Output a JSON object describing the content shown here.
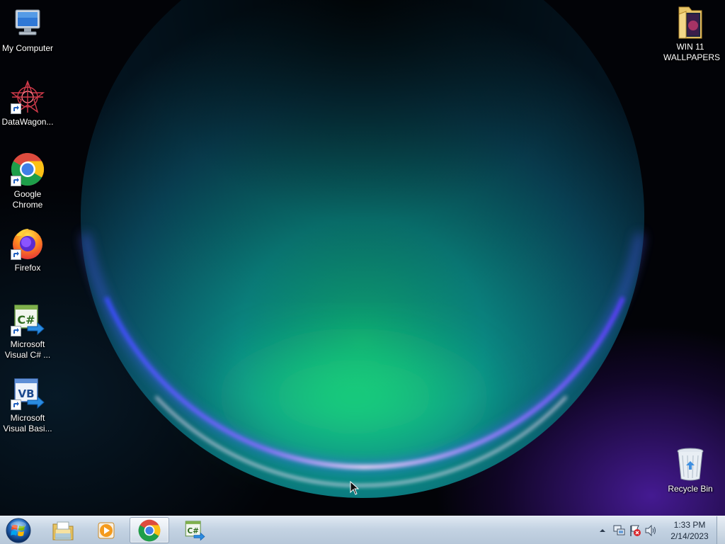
{
  "desktop": {
    "icons_left": [
      {
        "label": "My Computer",
        "icon": "computer-icon"
      },
      {
        "label": "DataWagon...",
        "icon": "datawagon-icon"
      },
      {
        "label": "Google Chrome",
        "icon": "chrome-icon"
      },
      {
        "label": "Firefox",
        "icon": "firefox-icon"
      },
      {
        "label": "Microsoft Visual C# ...",
        "icon": "visual-csharp-icon"
      },
      {
        "label": "Microsoft Visual Basi...",
        "icon": "visual-basic-icon"
      }
    ],
    "folder": {
      "label": "WIN 11 WALLPAPERS",
      "icon": "folder-icon"
    },
    "recycle_bin": {
      "label": "Recycle Bin",
      "icon": "recycle-bin-icon"
    }
  },
  "taskbar": {
    "start_icon": "windows-logo-icon",
    "pinned": [
      {
        "name": "Windows Explorer",
        "icon": "explorer-folder-icon"
      },
      {
        "name": "Windows Media Player",
        "icon": "media-player-icon"
      },
      {
        "name": "Google Chrome",
        "icon": "chrome-icon",
        "active": true
      },
      {
        "name": "Microsoft Visual C#",
        "icon": "visual-csharp-icon"
      }
    ],
    "tray": {
      "icons": [
        "show-hidden-icons-arrow",
        "network-icon",
        "action-center-flag-icon",
        "volume-icon"
      ],
      "time": "1:33 PM",
      "date": "2/14/2023"
    }
  }
}
